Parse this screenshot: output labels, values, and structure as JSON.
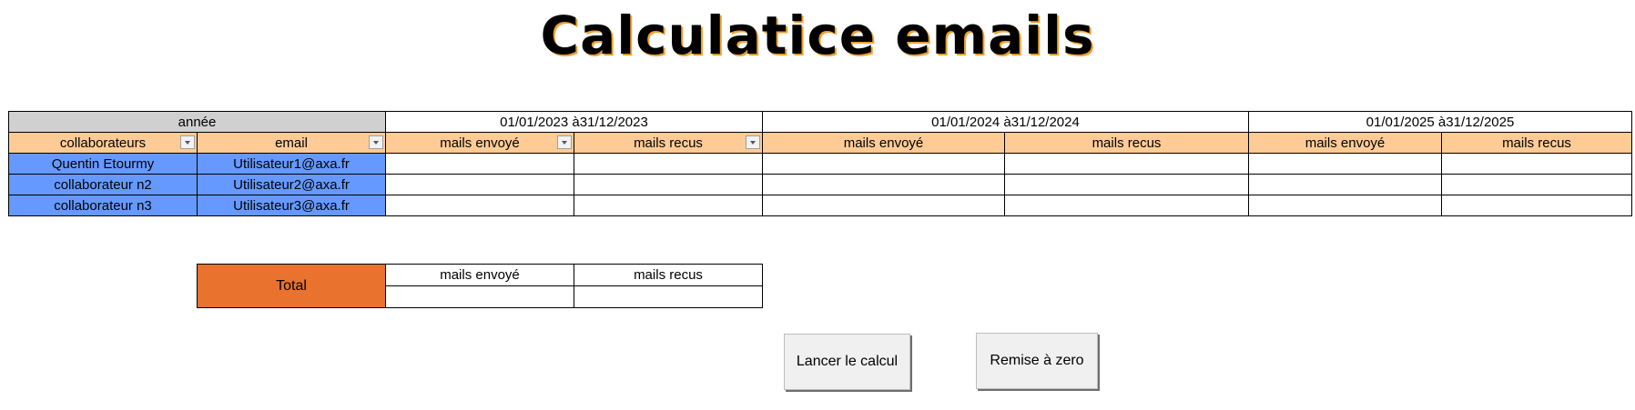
{
  "title": "Calculatice emails",
  "main_table": {
    "year_label": "année",
    "periods": [
      "01/01/2023 à31/12/2023",
      "01/01/2024 à31/12/2024",
      "01/01/2025 à31/12/2025"
    ],
    "headers": {
      "collaborateurs": "collaborateurs",
      "email": "email",
      "sent": "mails envoyé",
      "received": "mails recus"
    },
    "rows": [
      {
        "name": "Quentin Etourmy",
        "email": "Utilisateur1@axa.fr"
      },
      {
        "name": "collaborateur n2",
        "email": "Utilisateur2@axa.fr"
      },
      {
        "name": "collaborateur n3",
        "email": "Utilisateur3@axa.fr"
      }
    ]
  },
  "total_table": {
    "label": "Total",
    "sent": "mails envoyé",
    "received": "mails recus"
  },
  "buttons": {
    "run": "Lancer le calcul",
    "reset": "Remise à zero"
  },
  "colors": {
    "header_gray": "#d0d0d0",
    "header_peach": "#fecb97",
    "row_blue": "#6699ff",
    "total_orange": "#e9722e"
  }
}
